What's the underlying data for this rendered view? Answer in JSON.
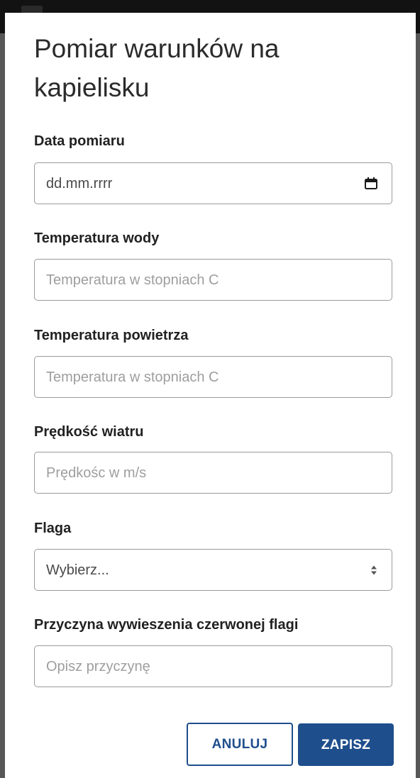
{
  "dialog": {
    "title": "Pomiar warunków na kapielisku"
  },
  "fields": {
    "date": {
      "label": "Data pomiaru",
      "value": "dd.mm.rrrr",
      "icon": "calendar-icon"
    },
    "water_temp": {
      "label": "Temperatura wody",
      "placeholder": "Temperatura w stopniach C"
    },
    "air_temp": {
      "label": "Temperatura powietrza",
      "placeholder": "Temperatura w stopniach C"
    },
    "wind_speed": {
      "label": "Prędkość wiatru",
      "placeholder": "Prędkośc w m/s"
    },
    "flag": {
      "label": "Flaga",
      "selected": "Wybierz...",
      "icon": "select-arrows-icon"
    },
    "red_flag_reason": {
      "label": "Przyczyna wywieszenia czerwonej flagi",
      "placeholder": "Opisz przyczynę"
    }
  },
  "buttons": {
    "cancel": "ANULUJ",
    "save": "ZAPISZ"
  },
  "colors": {
    "primary": "#1f4e8c",
    "overlay": "#6b6b6b",
    "status_bar": "#121212"
  }
}
